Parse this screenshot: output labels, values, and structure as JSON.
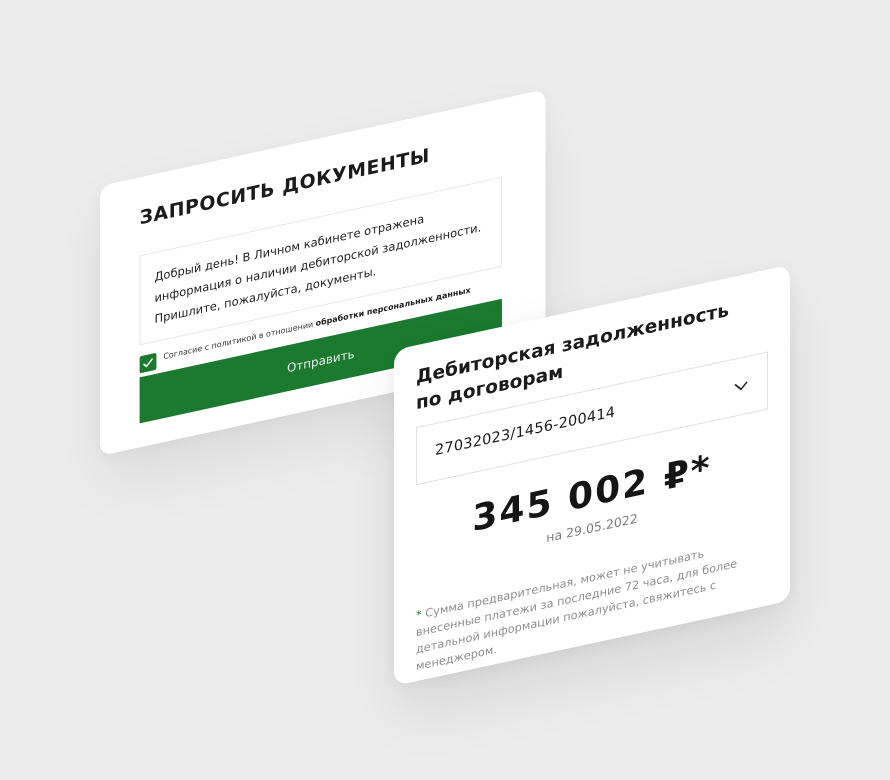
{
  "request_form": {
    "title": "ЗАПРОСИТЬ ДОКУМЕНТЫ",
    "message": "Добрый день! В Личном кабинете отражена информация о наличии дебиторской задолженности. Пришлите, пожалуйста, документы.",
    "consent_prefix": "Согласие с политикой в отношении ",
    "consent_link": "обработки персональных данных",
    "consent_checked": true,
    "submit_label": "Отправить"
  },
  "receivables": {
    "title": "Дебиторская задолженность по договорам",
    "contract_value": "27032023/1456-200414",
    "amount": "345 002 ₽*",
    "date": "на 29.05.2022",
    "footnote_star": "*",
    "footnote": "Сумма предварительная, может не учитывать внесенные платежи за последние 72 часа, для более детальной информации пожалуйста, свяжитесь с менеджером."
  },
  "colors": {
    "accent": "#1b7a30",
    "background": "#ececec",
    "card": "#ffffff",
    "muted_text": "#8d8d8d"
  }
}
